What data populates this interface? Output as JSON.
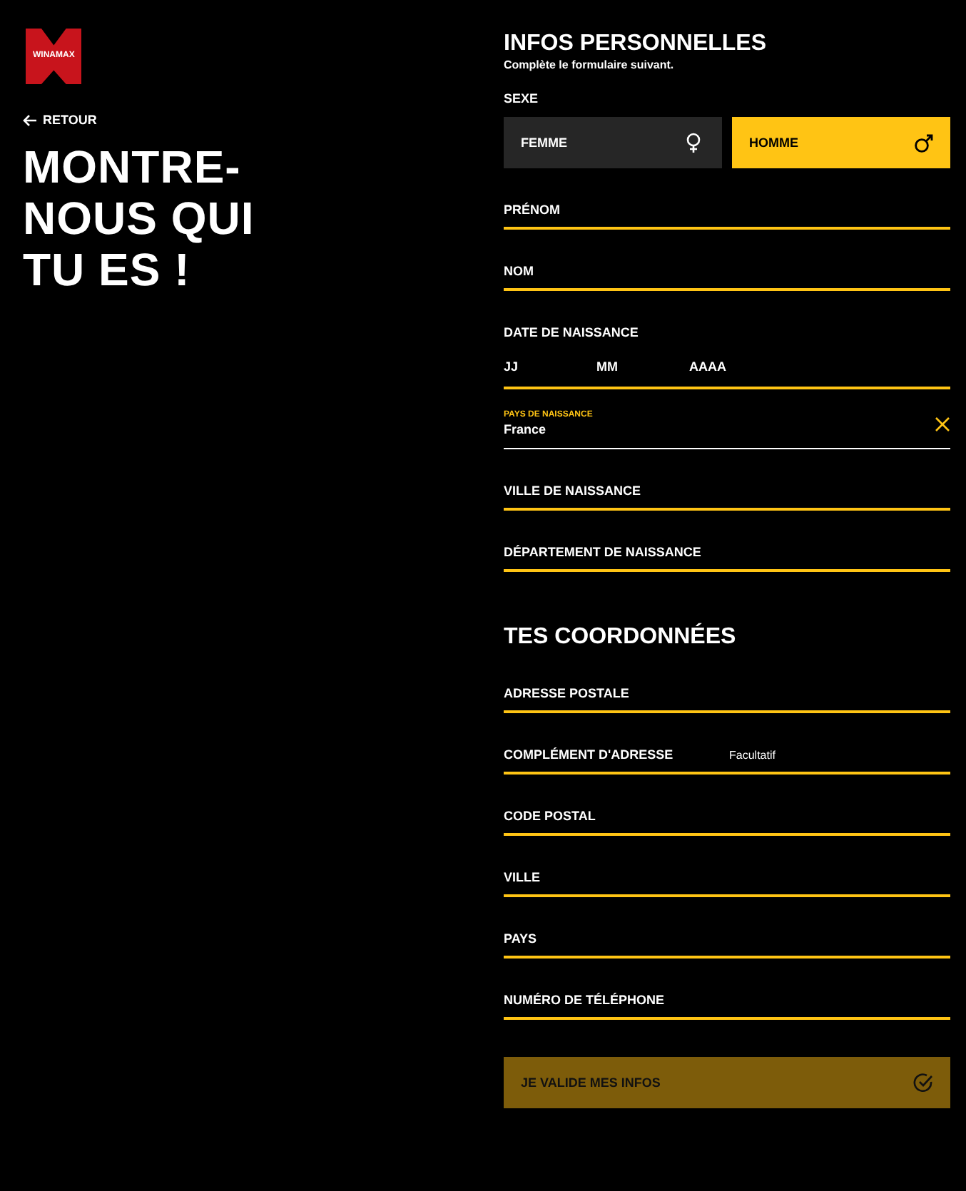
{
  "logo": {
    "text": "WINAMAX"
  },
  "back_link": {
    "label": "RETOUR"
  },
  "heading": [
    "MONTRE-",
    "NOUS QUI",
    "TU ES !"
  ],
  "sections": [
    {
      "title": "INFOS PERSONNELLES",
      "subtitle": "Complète le formulaire suivant.",
      "items": [
        {
          "kind": "gender",
          "label": "SEXE",
          "options": [
            {
              "label": "FEMME",
              "selected": false
            },
            {
              "label": "HOMME",
              "selected": true
            }
          ]
        },
        {
          "kind": "text",
          "placeholder": "PRÉNOM"
        },
        {
          "kind": "text",
          "placeholder": "NOM"
        },
        {
          "kind": "date",
          "label": "DATE DE NAISSANCE",
          "parts": [
            {
              "placeholder": "JJ"
            },
            {
              "placeholder": "MM"
            },
            {
              "placeholder": "AAAA"
            }
          ]
        },
        {
          "kind": "select",
          "label": "PAYS DE NAISSANCE",
          "value": "France"
        },
        {
          "kind": "text",
          "placeholder": "VILLE DE NAISSANCE"
        },
        {
          "kind": "text",
          "placeholder": "DÉPARTEMENT DE NAISSANCE"
        }
      ]
    },
    {
      "title": "TES COORDONNÉES",
      "items": [
        {
          "kind": "text",
          "placeholder": "ADRESSE POSTALE"
        },
        {
          "kind": "text",
          "placeholder": "COMPLÉMENT D'ADRESSE",
          "hint": "Facultatif"
        },
        {
          "kind": "text",
          "placeholder": "CODE POSTAL"
        },
        {
          "kind": "text",
          "placeholder": "VILLE"
        },
        {
          "kind": "text",
          "placeholder": "PAYS"
        },
        {
          "kind": "text",
          "placeholder": "NUMÉRO DE TÉLÉPHONE"
        }
      ]
    }
  ],
  "submit": {
    "label": "JE VALIDE MES INFOS",
    "disabled": true
  }
}
